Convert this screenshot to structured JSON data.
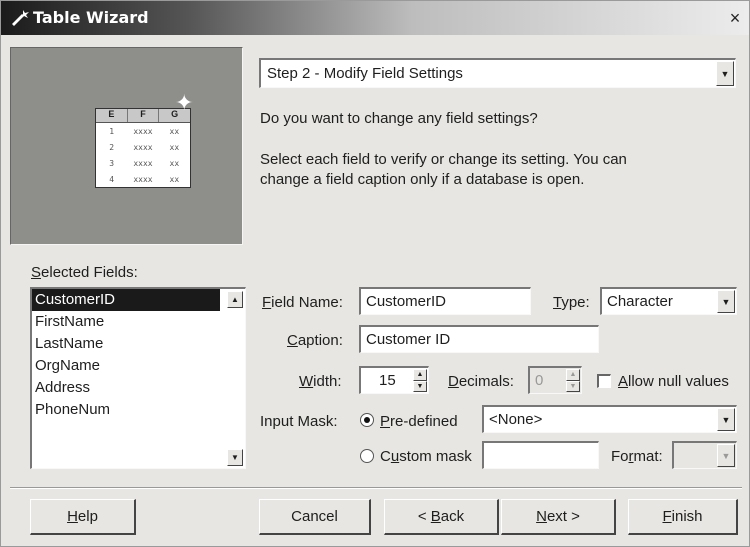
{
  "window": {
    "title": "Table Wizard",
    "close_glyph": "×"
  },
  "icons": {
    "title": "wand-icon",
    "close": "close-icon",
    "dropdown": "chevron-down-icon",
    "spin": "spinner-icon"
  },
  "preview": {
    "headers": [
      "E",
      "F",
      "G"
    ],
    "rows": [
      {
        "n": "1",
        "a": "xxxx",
        "b": "xx"
      },
      {
        "n": "2",
        "a": "xxxx",
        "b": "xx"
      },
      {
        "n": "3",
        "a": "xxxx",
        "b": "xx"
      },
      {
        "n": "4",
        "a": "xxxx",
        "b": "xx"
      }
    ]
  },
  "step": {
    "selected": "Step 2 - Modify Field Settings"
  },
  "question": "Do you want to change any field settings?",
  "instruction": "Select each field to verify or change its setting. You can change a field caption only if a database is open.",
  "selected_fields": {
    "label_ul": "S",
    "label_rest": "elected Fields:",
    "items": [
      "CustomerID",
      "FirstName",
      "LastName",
      "OrgName",
      "Address",
      "PhoneNum"
    ],
    "selected_index": 0
  },
  "form": {
    "field_name": {
      "ul": "F",
      "rest": "ield Name:",
      "value": "CustomerID"
    },
    "type": {
      "ul": "T",
      "rest": "ype:",
      "value": "Character"
    },
    "caption": {
      "ul": "C",
      "rest": "aption:",
      "value": "Customer ID"
    },
    "width": {
      "ul": "W",
      "rest": "idth:",
      "value": "15"
    },
    "decimals": {
      "ul": "D",
      "rest": "ecimals:",
      "value": "0"
    },
    "allow_null": {
      "ul": "A",
      "rest": "llow null values",
      "checked": false
    },
    "input_mask": {
      "label": "Input Mask:",
      "predefined": {
        "ul": "P",
        "rest": "re-defined",
        "selected": true
      },
      "predefined_value": "<None>",
      "custom": {
        "pre": "C",
        "ul": "u",
        "rest": "stom mask",
        "selected": false
      },
      "custom_value": ""
    },
    "format": {
      "pre": "Fo",
      "ul": "r",
      "rest": "mat:",
      "value": ""
    }
  },
  "buttons": {
    "help": {
      "ul": "H",
      "rest": "elp"
    },
    "cancel": {
      "label": "Cancel"
    },
    "back": {
      "pre": "< ",
      "ul": "B",
      "rest": "ack"
    },
    "next": {
      "ul": "N",
      "rest": "ext >"
    },
    "finish": {
      "ul": "F",
      "rest": "inish"
    }
  }
}
